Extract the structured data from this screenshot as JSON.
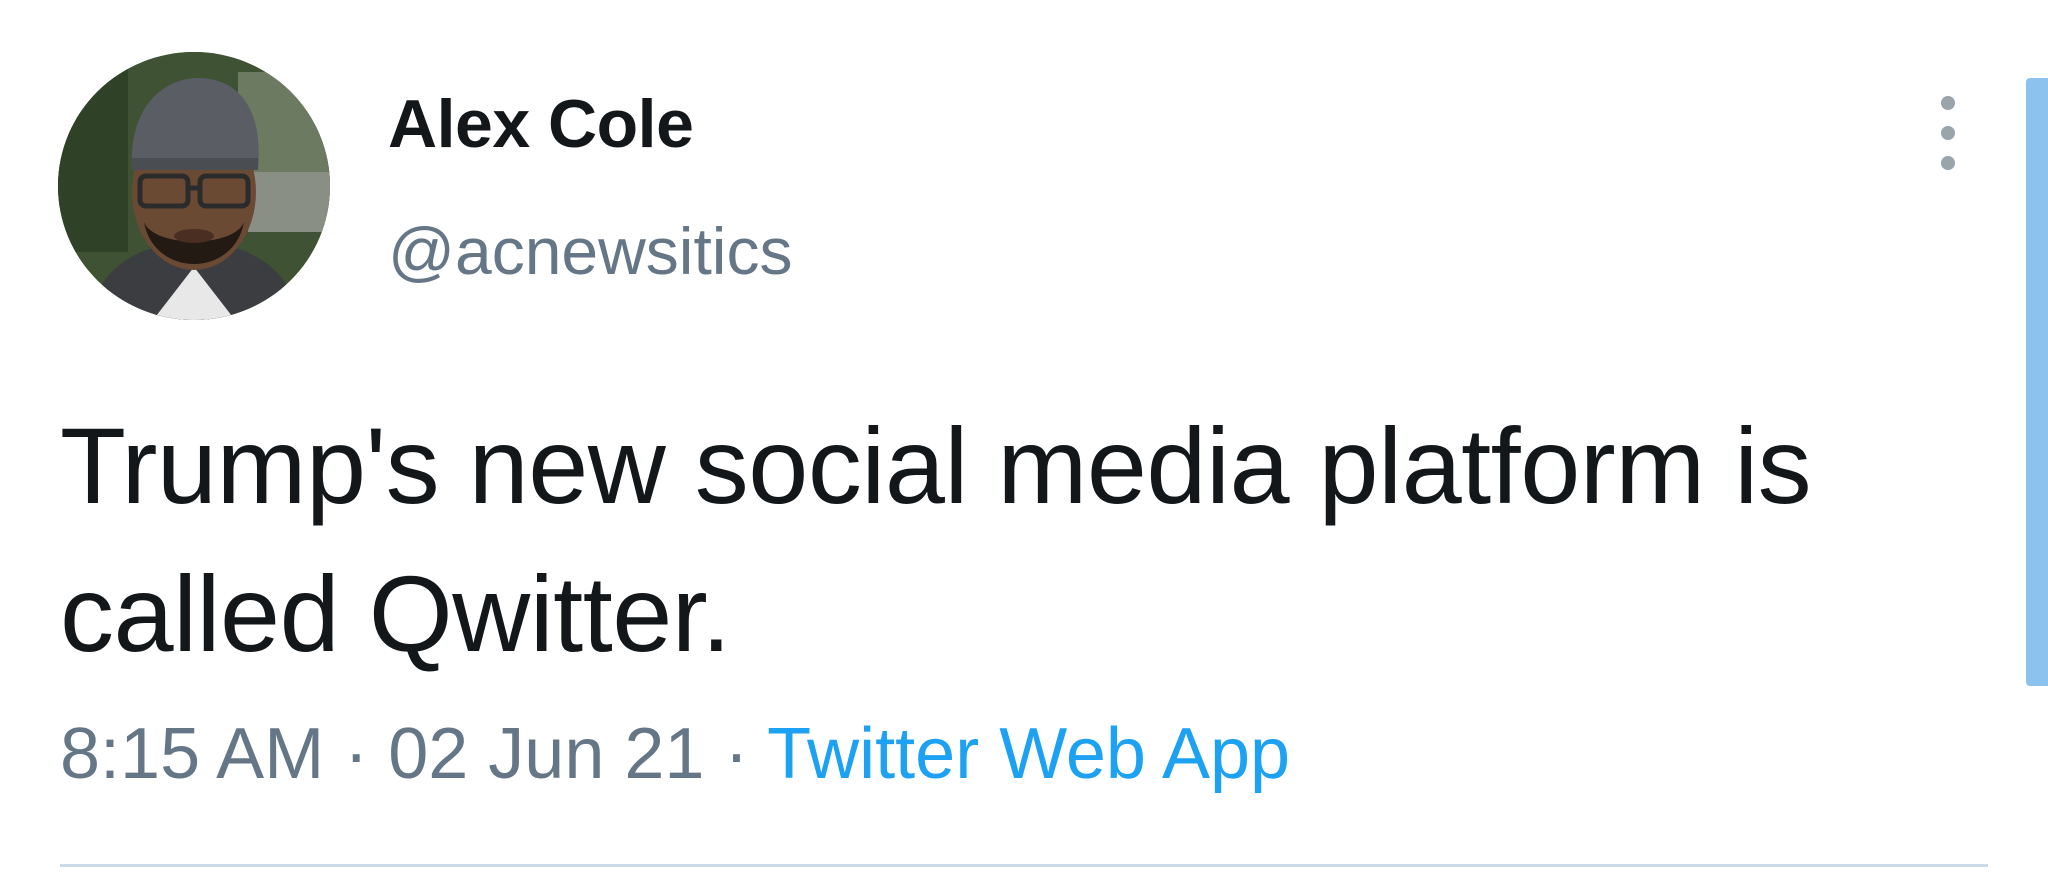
{
  "tweet": {
    "display_name": "Alex Cole",
    "handle": "@acnewsitics",
    "text": "Trump's new social media platform is called Qwitter.",
    "time": "8:15 AM",
    "separator": "·",
    "date": "02 Jun 21",
    "source": "Twitter Web App",
    "avatar_icon": "profile-photo",
    "menu_icon": "more-vertical-icon"
  },
  "colors": {
    "text": "#14171a",
    "secondary": "#657786",
    "link": "#1da1f2",
    "divider": "#c9dbe6",
    "scrollbar": "#8cc2ee"
  }
}
